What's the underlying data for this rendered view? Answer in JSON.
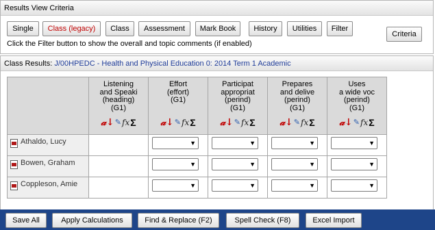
{
  "criteria": {
    "title": "Results View Criteria",
    "buttons": {
      "single": "Single",
      "class_legacy": "Class (legacy)",
      "class": "Class",
      "assessment": "Assessment",
      "mark_book": "Mark Book",
      "history": "History",
      "utilities": "Utilities",
      "filter": "Filter"
    },
    "criteria_button": "Criteria",
    "hint": "Click the Filter button to show the overall and topic comments (if enabled)"
  },
  "results": {
    "label": "Class Results:",
    "class_link": "J/00HPEDC - Health and Physical Education 0: 2014 Term 1 Academic",
    "columns": [
      {
        "lines": [
          "Listening",
          "and Speaki",
          "(heading)",
          "(G1)"
        ]
      },
      {
        "lines": [
          "Effort",
          "(effort)",
          "(G1)"
        ]
      },
      {
        "lines": [
          "Participat",
          "appropriat",
          "(perind)",
          "(G1)"
        ]
      },
      {
        "lines": [
          "Prepares",
          "and delive",
          "(perind)",
          "(G1)"
        ]
      },
      {
        "lines": [
          "Uses",
          "a wide voc",
          "(perind)",
          "(G1)"
        ]
      }
    ],
    "icons": [
      "sort-a-icon",
      "edit-pencil-icon",
      "fx-icon",
      "sigma-icon"
    ],
    "students": [
      {
        "name": "Athaldo, Lucy"
      },
      {
        "name": "Bowen, Graham"
      },
      {
        "name": "Coppleson, Amie"
      }
    ]
  },
  "bottom": {
    "save_all": "Save All",
    "apply_calculations": "Apply Calculations",
    "find_replace": "Find & Replace (F2)",
    "spell_check": "Spell Check (F8)",
    "excel_import": "Excel Import"
  },
  "colors": {
    "bottom_bar": "#1e4589",
    "class_link": "#1f3c99",
    "legacy_text": "#c00000"
  }
}
